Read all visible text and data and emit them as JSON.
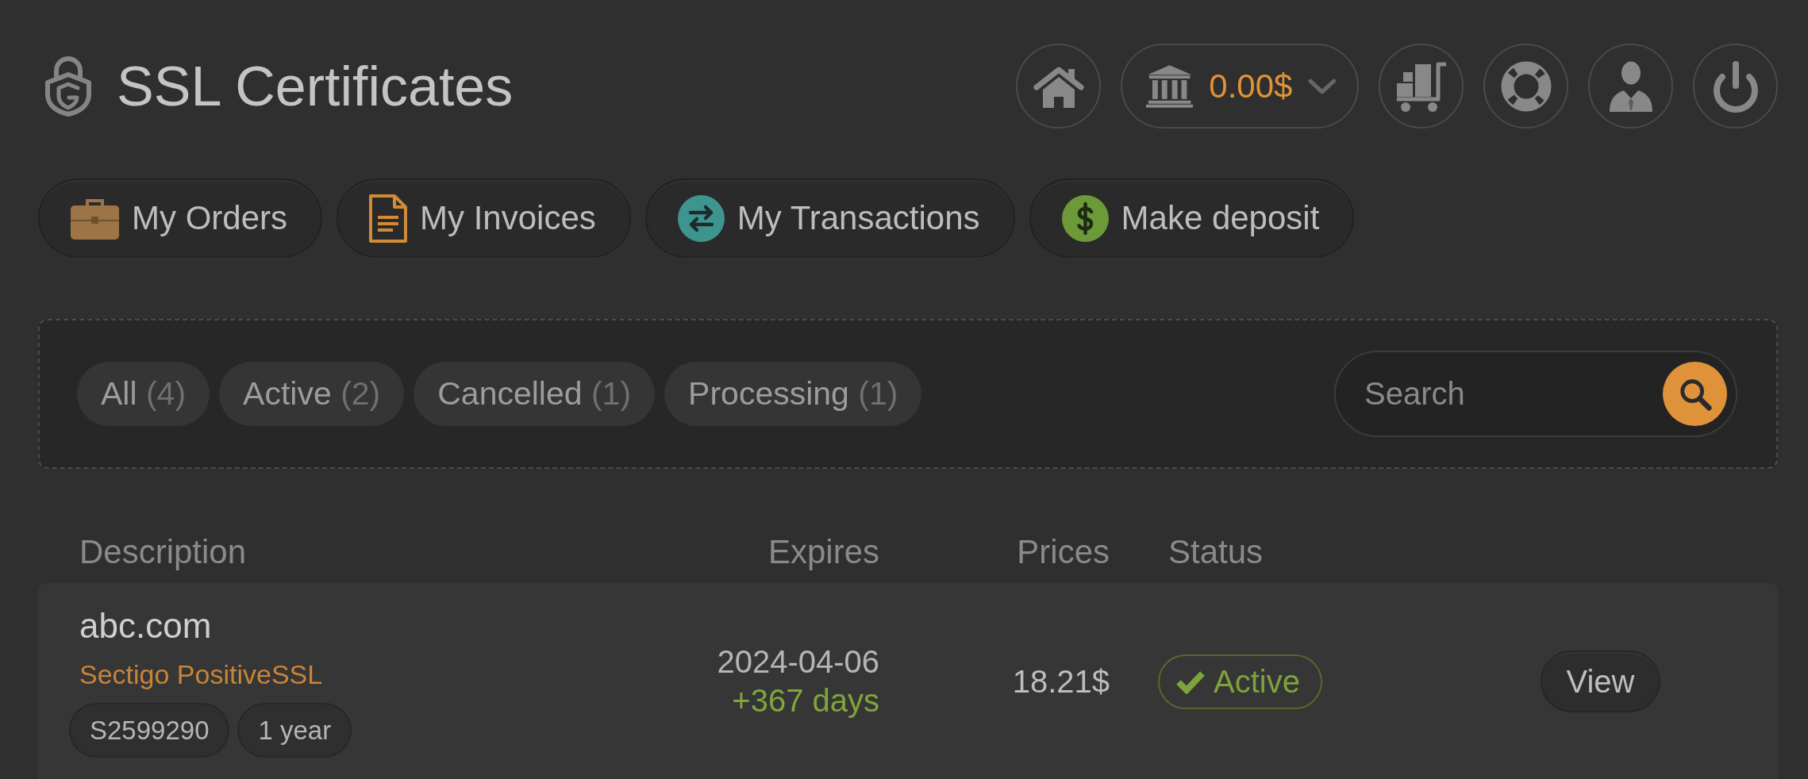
{
  "header": {
    "title": "SSL Certificates",
    "balance": "0.00$"
  },
  "nav": [
    {
      "label": "My Orders",
      "kind": "orders"
    },
    {
      "label": "My Invoices",
      "kind": "invoices"
    },
    {
      "label": "My Transactions",
      "kind": "transactions"
    },
    {
      "label": "Make deposit",
      "kind": "deposit"
    }
  ],
  "filters": [
    {
      "label": "All",
      "count": "(4)"
    },
    {
      "label": "Active",
      "count": "(2)"
    },
    {
      "label": "Cancelled",
      "count": "(1)"
    },
    {
      "label": "Processing",
      "count": "(1)"
    }
  ],
  "search": {
    "placeholder": "Search"
  },
  "table": {
    "columns": [
      "Description",
      "Expires",
      "Prices",
      "Status"
    ],
    "rows": [
      {
        "domain": "abc.com",
        "product": "Sectigo PositiveSSL",
        "order_id": "S2599290",
        "term": "1 year",
        "expires": "2024-04-06",
        "remaining": "+367 days",
        "price": "18.21$",
        "status": {
          "label": "Active",
          "kind": "active"
        },
        "action": "View"
      }
    ]
  }
}
